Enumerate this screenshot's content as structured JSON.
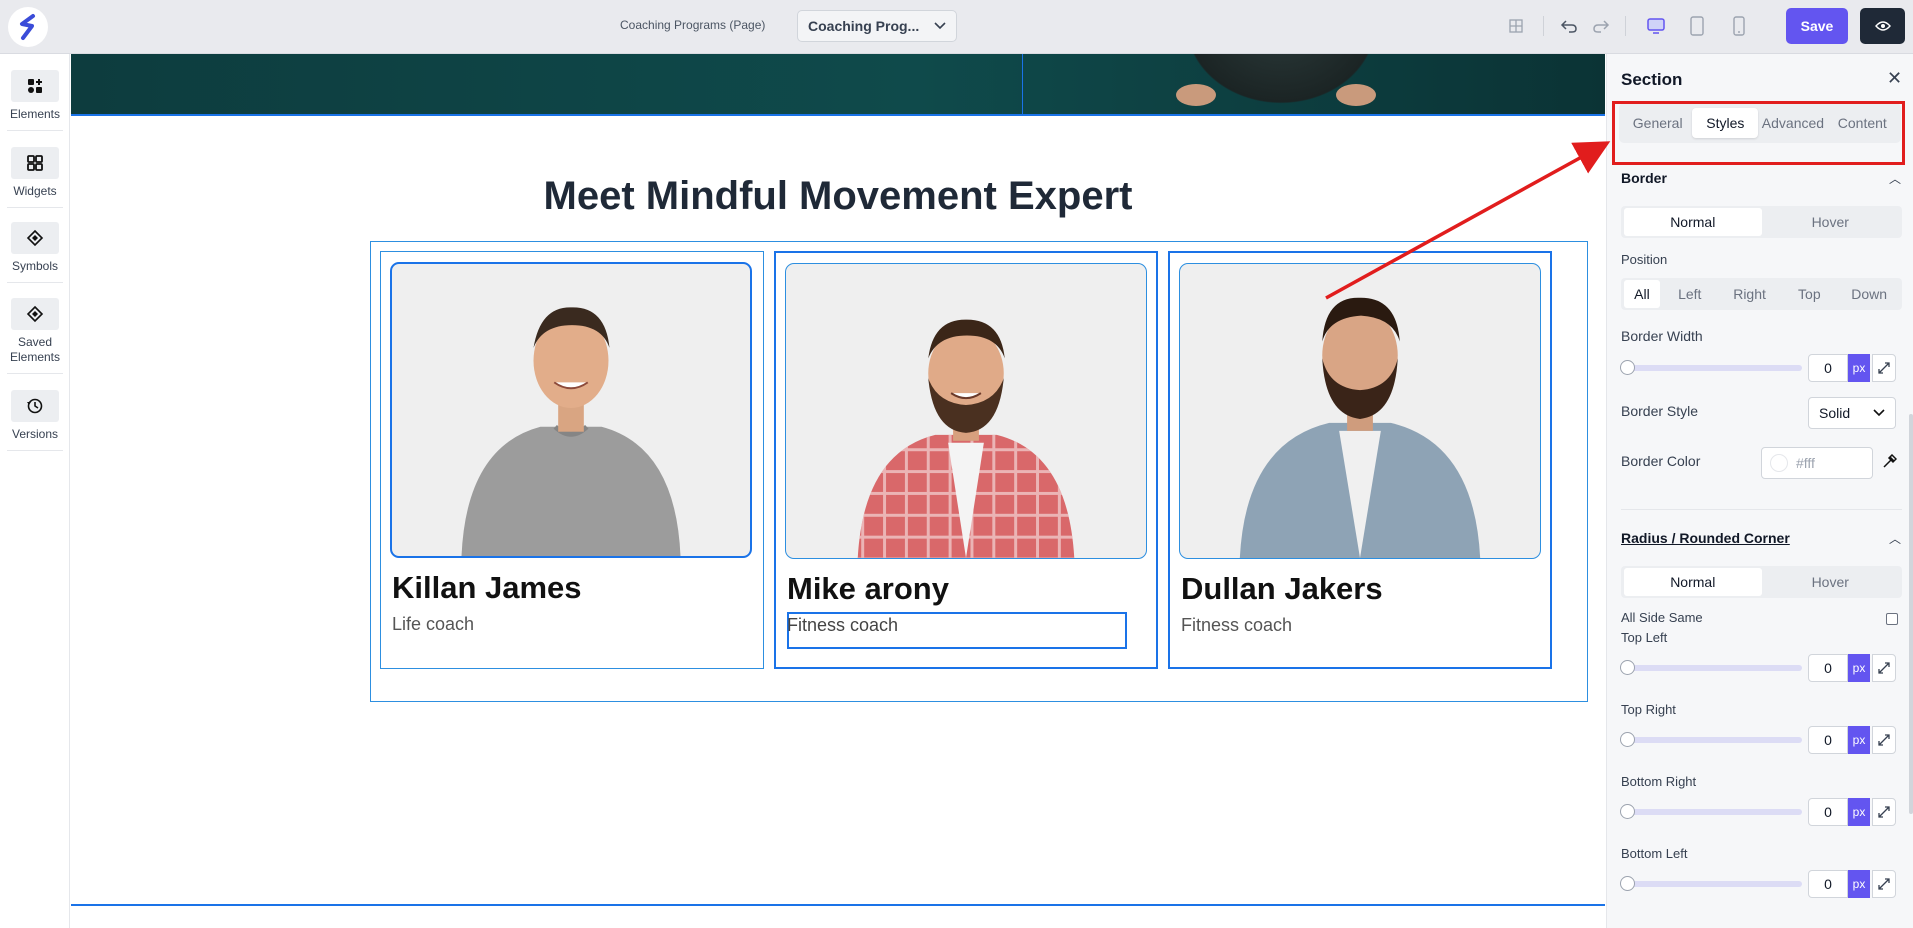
{
  "topbar": {
    "page_label": "Coaching Programs (Page)",
    "page_select": "Coaching Prog...",
    "save_label": "Save"
  },
  "leftrail": {
    "items": [
      {
        "label": "Elements",
        "icon": "elements-icon"
      },
      {
        "label": "Widgets",
        "icon": "widgets-icon"
      },
      {
        "label": "Symbols",
        "icon": "symbols-icon"
      },
      {
        "label": "Saved Elements",
        "icon": "saved-elements-icon"
      },
      {
        "label": "Versions",
        "icon": "history-icon"
      }
    ]
  },
  "canvas": {
    "section_title": "Meet Mindful Movement Expert",
    "cards": [
      {
        "name": "Killan James",
        "role": "Life coach",
        "shirt": "#9a9a9a"
      },
      {
        "name": "Mike arony",
        "role": "Fitness coach",
        "shirt": "#d9686a"
      },
      {
        "name": "Dullan Jakers",
        "role": "Fitness coach",
        "shirt": "#8ea3b5"
      }
    ]
  },
  "panel": {
    "title": "Section",
    "tabs": [
      "General",
      "Styles",
      "Advanced",
      "Content"
    ],
    "active_tab": "Styles",
    "border": {
      "heading": "Border",
      "state_tabs": [
        "Normal",
        "Hover"
      ],
      "position_label": "Position",
      "positions": [
        "All",
        "Left",
        "Right",
        "Top",
        "Down"
      ],
      "width_label": "Border Width",
      "width_value": "0",
      "unit": "px",
      "style_label": "Border Style",
      "style_value": "Solid",
      "color_label": "Border Color",
      "color_placeholder": "#fff"
    },
    "radius": {
      "heading": "Radius / Rounded Corner",
      "state_tabs": [
        "Normal",
        "Hover"
      ],
      "all_side_same": "All Side Same",
      "top_left": "Top Left",
      "top_right": "Top Right",
      "bottom_right": "Bottom Right",
      "bottom_left": "Bottom Left",
      "value": "0",
      "unit": "px"
    }
  },
  "colors": {
    "accent": "#6355f0",
    "selection": "#1a73e8",
    "annotation": "#e11d1d"
  }
}
